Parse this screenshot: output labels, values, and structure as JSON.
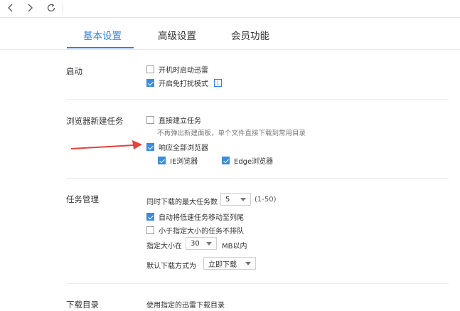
{
  "nav": {
    "back_icon": "chevron-left-icon",
    "forward_icon": "chevron-right-icon",
    "refresh_icon": "refresh-icon"
  },
  "tabs": [
    {
      "label": "基本设置",
      "active": true
    },
    {
      "label": "高级设置",
      "active": false
    },
    {
      "label": "会员功能",
      "active": false
    }
  ],
  "startup": {
    "title": "启动",
    "auto_start": {
      "label": "开机时启动迅雷",
      "checked": false
    },
    "no_disturb": {
      "label": "开启免打扰模式",
      "checked": true
    },
    "info_glyph": "i"
  },
  "browser_task": {
    "title": "浏览器新建任务",
    "direct_create": {
      "label": "直接建立任务",
      "checked": false
    },
    "direct_desc": "不再弹出新建面板，单个文件直接下载到常用目录",
    "respond_all": {
      "label": "响应全部浏览器",
      "checked": true
    },
    "ie": {
      "label": "IE浏览器",
      "checked": true
    },
    "edge": {
      "label": "Edge浏览器",
      "checked": true
    }
  },
  "task_mgmt": {
    "title": "任务管理",
    "max_label": "同时下载的最大任务数",
    "max_value": "5",
    "max_range": "(1-50)",
    "move_slow": {
      "label": "自动将低速任务移动至列尾",
      "checked": true
    },
    "no_queue_small": {
      "label": "小于指定大小的任务不排队",
      "checked": false
    },
    "size_label": "指定大小在",
    "size_value": "30",
    "size_unit": "MB以内",
    "default_mode_label": "默认下载方式为",
    "default_mode_value": "立即下载"
  },
  "download_dir": {
    "title": "下载目录",
    "option_label": "使用指定的迅雷下载目录"
  },
  "colors": {
    "accent": "#2d83e8",
    "arrow": "#e8403a",
    "checkbox": "#3b8be0"
  }
}
